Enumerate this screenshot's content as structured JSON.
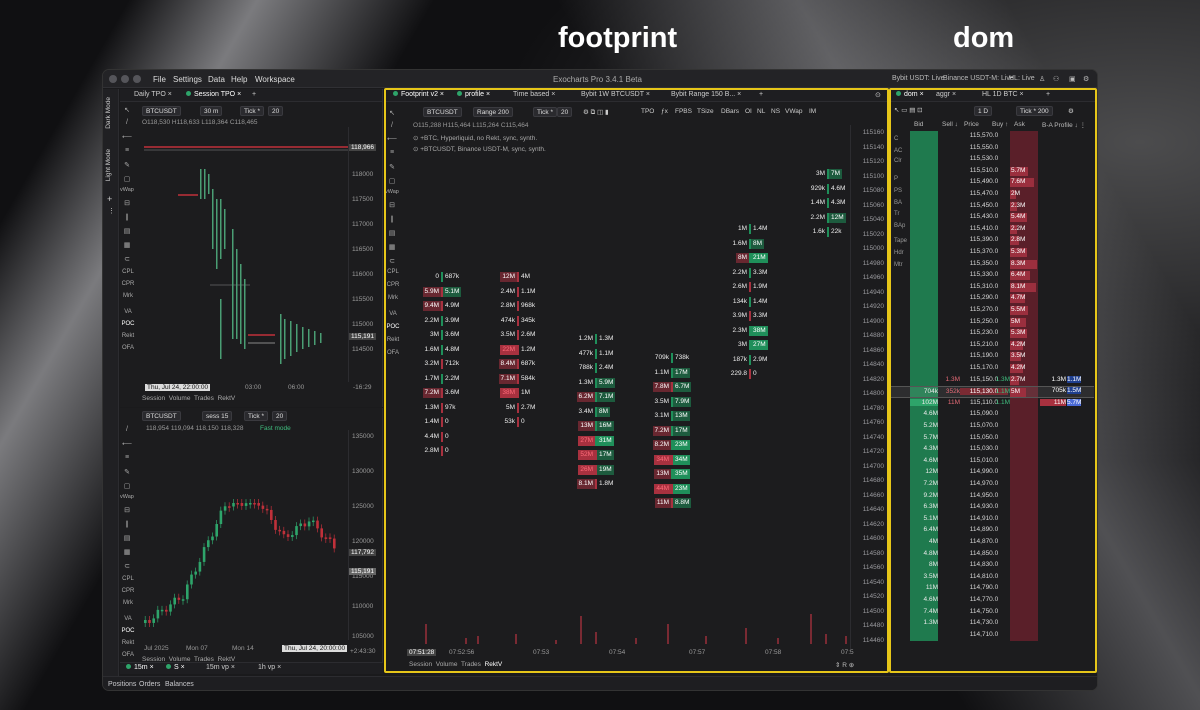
{
  "headings": {
    "footprint": "footprint",
    "dom": "dom"
  },
  "window": {
    "title": "Exocharts Pro 3.4.1 Beta",
    "menu": [
      "File",
      "Settings",
      "Data",
      "Help",
      "Workspace"
    ],
    "status": [
      "Bybit USDT: Live",
      "Binance USDT-M: Live",
      "HL: Live"
    ]
  },
  "side_labels": {
    "dark": "Dark Mode",
    "light": "Light Mode"
  },
  "tpo_pane": {
    "tabs": [
      "Daily TPO",
      "Session TPO"
    ],
    "symbol": "BTCUSDT",
    "tf": "30 m",
    "tick": "Tick *",
    "tick_val": "20",
    "ohlc": "O118,530 H118,633 L118,364 C118,465",
    "yaxis": [
      "118500",
      "118000",
      "117500",
      "117000",
      "116500",
      "116000",
      "115500",
      "115000",
      "114500"
    ],
    "tag_hi": "118,966",
    "tag_lo": "115,191",
    "date": "Thu, Jul 24, 22:00:00",
    "x": [
      "03:00",
      "06:00"
    ],
    "timer": "-16:29",
    "bottom": [
      "Session",
      "Volume",
      "Trades",
      "RektV"
    ]
  },
  "candle_pane": {
    "symbol": "BTCUSDT",
    "sess": "sess 15",
    "tick": "Tick *",
    "tick_val": "20",
    "ohlc": "118,954  119,094  118,150  118,328",
    "mode": "Fast mode",
    "yaxis": [
      "135000",
      "130000",
      "125000",
      "120000",
      "115000",
      "110000",
      "105000"
    ],
    "tag_a": "117,792",
    "tag_b": "115,191",
    "x": [
      "Jul 2025",
      "Mon 07",
      "Mon 14"
    ],
    "date": "Thu, Jul 24, 20:00:00",
    "timer": "+2:43:30",
    "bottom": [
      "Session",
      "Volume",
      "Trades",
      "RektV"
    ],
    "layout_tabs": [
      "15m",
      "S",
      "15m vp",
      "1h vp"
    ]
  },
  "left_tools": [
    "vWap",
    "CPL",
    "CPR",
    "Mrk",
    "VA",
    "POC",
    "Rekt",
    "OFA"
  ],
  "footprint_pane": {
    "tabs": [
      "Footprint v2",
      "profile",
      "Time based",
      "Bybit 1W BTCUSDT",
      "Bybit Range 150 B..."
    ],
    "symbol": "BTCUSDT",
    "range": "Range 200",
    "tick": "Tick *",
    "tick_val": "20",
    "toolbar": [
      "TPO",
      "FPBS",
      "TSize",
      "DBars",
      "OI",
      "NL",
      "NS",
      "VWap",
      "IM"
    ],
    "ohlc": "O115,288 H115,464 L115,264 C115,464",
    "sources": [
      "+BTC, Hyperliquid, no Rekt, sync, synth.",
      "+BTCUSDT, Binance USDT-M, sync, synth."
    ],
    "yaxis": [
      "115160",
      "115140",
      "115120",
      "115100",
      "115080",
      "115060",
      "115040",
      "115020",
      "115000",
      "114980",
      "114960",
      "114940",
      "114920",
      "114900",
      "114880",
      "114860",
      "114840",
      "114820",
      "114800",
      "114780",
      "114760",
      "114740",
      "114720",
      "114700",
      "114680",
      "114660",
      "114640",
      "114620",
      "114600",
      "114580",
      "114560",
      "114540",
      "114520",
      "114500",
      "114480",
      "114460"
    ],
    "time_tag": "07:51:28",
    "x": [
      "07:52:56",
      "07:53",
      "07:54",
      "07:57",
      "07:58",
      "07:5"
    ],
    "bottom": [
      "Session",
      "Volume",
      "Trades",
      "RektV"
    ],
    "columns": [
      [
        [
          "0",
          "687k"
        ],
        [
          "5.9M",
          "5.1M"
        ],
        [
          "9.4M",
          "4.9M"
        ],
        [
          "2.2M",
          "3.9M"
        ],
        [
          "3M",
          "3.6M"
        ],
        [
          "1.6M",
          "4.8M"
        ],
        [
          "3.2M",
          "712k"
        ],
        [
          "1.7M",
          "2.2M"
        ],
        [
          "7.2M",
          "3.6M"
        ],
        [
          "1.3M",
          "97k"
        ],
        [
          "1.4M",
          "0"
        ],
        [
          "4.4M",
          "0"
        ],
        [
          "2.8M",
          "0"
        ]
      ],
      [
        [
          "12M",
          "4M"
        ],
        [
          "2.4M",
          "1.1M"
        ],
        [
          "2.8M",
          "968k"
        ],
        [
          "474k",
          "345k"
        ],
        [
          "3.5M",
          "2.6M"
        ],
        [
          "22M",
          "1.2M"
        ],
        [
          "8.4M",
          "687k"
        ],
        [
          "7.1M",
          "584k"
        ],
        [
          "38M",
          "1M"
        ],
        [
          "5M",
          "2.7M"
        ],
        [
          "53k",
          "0"
        ]
      ],
      [
        [
          "1.2M",
          "1.3M"
        ],
        [
          "477k",
          "1.1M"
        ],
        [
          "788k",
          "2.4M"
        ],
        [
          "1.3M",
          "5.9M"
        ],
        [
          "6.2M",
          "7.1M"
        ],
        [
          "3.4M",
          "8M"
        ],
        [
          "13M",
          "16M"
        ],
        [
          "27M",
          "31M"
        ],
        [
          "52M",
          "17M"
        ],
        [
          "26M",
          "19M"
        ],
        [
          "8.1M",
          "1.8M"
        ]
      ],
      [
        [
          "709k",
          "738k"
        ],
        [
          "1.1M",
          "17M"
        ],
        [
          "7.8M",
          "6.7M"
        ],
        [
          "3.5M",
          "7.9M"
        ],
        [
          "3.1M",
          "13M"
        ],
        [
          "7.2M",
          "17M"
        ],
        [
          "8.2M",
          "23M"
        ],
        [
          "34M",
          "34M"
        ],
        [
          "13M",
          "35M"
        ],
        [
          "44M",
          "23M"
        ],
        [
          "11M",
          "8.8M"
        ]
      ],
      [
        [
          "1M",
          "1.4M"
        ],
        [
          "1.6M",
          "8M"
        ],
        [
          "8M",
          "21M"
        ],
        [
          "2.2M",
          "3.3M"
        ],
        [
          "2.6M",
          "1.9M"
        ],
        [
          "134k",
          "1.4M"
        ],
        [
          "3.9M",
          "3.3M"
        ],
        [
          "2.3M",
          "38M"
        ],
        [
          "3M",
          "27M"
        ],
        [
          "187k",
          "2.9M"
        ],
        [
          "229.8",
          "0"
        ]
      ],
      [
        [
          "3M",
          "7M"
        ],
        [
          "929k",
          "4.6M"
        ],
        [
          "1.4M",
          "4.3M"
        ],
        [
          "2.2M",
          "12M"
        ],
        [
          "1.6k",
          "22k"
        ]
      ]
    ]
  },
  "dom_pane": {
    "tabs": [
      "dom",
      "aggr",
      "HL 1D BTC"
    ],
    "tick": "Tick * 200",
    "scale": "1 D",
    "headers": [
      "Bid",
      "Sell",
      "Price",
      "Buy",
      "Ask",
      "B-A Profile"
    ],
    "side_codes": [
      "C",
      "AC",
      "Clr",
      "P",
      "PS",
      "BA",
      "Tr",
      "BAp",
      "Tape",
      "Hdr",
      "Mtr"
    ],
    "rows": [
      {
        "bid": "",
        "sell": "",
        "price": "115,570.0",
        "buy": "",
        "ask": ""
      },
      {
        "bid": "",
        "sell": "",
        "price": "115,550.0",
        "buy": "",
        "ask": ""
      },
      {
        "bid": "",
        "sell": "",
        "price": "115,530.0",
        "buy": "",
        "ask": ""
      },
      {
        "bid": "",
        "sell": "",
        "price": "115,510.0",
        "buy": "",
        "ask": "5.7M"
      },
      {
        "bid": "",
        "sell": "",
        "price": "115,490.0",
        "buy": "",
        "ask": "7.6M"
      },
      {
        "bid": "",
        "sell": "",
        "price": "115,470.0",
        "buy": "",
        "ask": "2M"
      },
      {
        "bid": "",
        "sell": "",
        "price": "115,450.0",
        "buy": "",
        "ask": "2.3M"
      },
      {
        "bid": "",
        "sell": "",
        "price": "115,430.0",
        "buy": "",
        "ask": "5.4M"
      },
      {
        "bid": "",
        "sell": "",
        "price": "115,410.0",
        "buy": "",
        "ask": "2.2M"
      },
      {
        "bid": "",
        "sell": "",
        "price": "115,390.0",
        "buy": "",
        "ask": "2.8M"
      },
      {
        "bid": "",
        "sell": "",
        "price": "115,370.0",
        "buy": "",
        "ask": "5.3M"
      },
      {
        "bid": "",
        "sell": "",
        "price": "115,350.0",
        "buy": "",
        "ask": "8.3M"
      },
      {
        "bid": "",
        "sell": "",
        "price": "115,330.0",
        "buy": "",
        "ask": "6.4M"
      },
      {
        "bid": "",
        "sell": "",
        "price": "115,310.0",
        "buy": "",
        "ask": "8.1M"
      },
      {
        "bid": "",
        "sell": "",
        "price": "115,290.0",
        "buy": "",
        "ask": "4.7M"
      },
      {
        "bid": "",
        "sell": "",
        "price": "115,270.0",
        "buy": "",
        "ask": "5.5M"
      },
      {
        "bid": "",
        "sell": "",
        "price": "115,250.0",
        "buy": "",
        "ask": "5M"
      },
      {
        "bid": "",
        "sell": "",
        "price": "115,230.0",
        "buy": "",
        "ask": "5.3M"
      },
      {
        "bid": "",
        "sell": "",
        "price": "115,210.0",
        "buy": "",
        "ask": "4.2M"
      },
      {
        "bid": "",
        "sell": "",
        "price": "115,190.0",
        "buy": "",
        "ask": "3.5M"
      },
      {
        "bid": "",
        "sell": "",
        "price": "115,170.0",
        "buy": "",
        "ask": "4.2M"
      },
      {
        "bid": "",
        "sell": "1.3M",
        "price": "115,150.0",
        "buy": "1.3M",
        "ask": "2.7M"
      },
      {
        "bid": "704k",
        "sell": "352k",
        "price": "115,130.0",
        "buy": "1.1M",
        "ask": "5M"
      },
      {
        "bid": "102M",
        "sell": "11M",
        "price": "115,110.0",
        "buy": "1.1M",
        "ask": ""
      },
      {
        "bid": "4.6M",
        "sell": "",
        "price": "115,090.0",
        "buy": "",
        "ask": ""
      },
      {
        "bid": "5.2M",
        "sell": "",
        "price": "115,070.0",
        "buy": "",
        "ask": ""
      },
      {
        "bid": "5.7M",
        "sell": "",
        "price": "115,050.0",
        "buy": "",
        "ask": ""
      },
      {
        "bid": "4.3M",
        "sell": "",
        "price": "115,030.0",
        "buy": "",
        "ask": ""
      },
      {
        "bid": "4.6M",
        "sell": "",
        "price": "115,010.0",
        "buy": "",
        "ask": ""
      },
      {
        "bid": "12M",
        "sell": "",
        "price": "114,990.0",
        "buy": "",
        "ask": ""
      },
      {
        "bid": "7.2M",
        "sell": "",
        "price": "114,970.0",
        "buy": "",
        "ask": ""
      },
      {
        "bid": "9.2M",
        "sell": "",
        "price": "114,950.0",
        "buy": "",
        "ask": ""
      },
      {
        "bid": "6.3M",
        "sell": "",
        "price": "114,930.0",
        "buy": "",
        "ask": ""
      },
      {
        "bid": "5.1M",
        "sell": "",
        "price": "114,910.0",
        "buy": "",
        "ask": ""
      },
      {
        "bid": "6.4M",
        "sell": "",
        "price": "114,890.0",
        "buy": "",
        "ask": ""
      },
      {
        "bid": "4M",
        "sell": "",
        "price": "114,870.0",
        "buy": "",
        "ask": ""
      },
      {
        "bid": "4.8M",
        "sell": "",
        "price": "114,850.0",
        "buy": "",
        "ask": ""
      },
      {
        "bid": "8M",
        "sell": "",
        "price": "114,830.0",
        "buy": "",
        "ask": ""
      },
      {
        "bid": "3.5M",
        "sell": "",
        "price": "114,810.0",
        "buy": "",
        "ask": ""
      },
      {
        "bid": "11M",
        "sell": "",
        "price": "114,790.0",
        "buy": "",
        "ask": ""
      },
      {
        "bid": "4.6M",
        "sell": "",
        "price": "114,770.0",
        "buy": "",
        "ask": ""
      },
      {
        "bid": "7.4M",
        "sell": "",
        "price": "114,750.0",
        "buy": "",
        "ask": ""
      },
      {
        "bid": "1.3M",
        "sell": "",
        "price": "114,730.0",
        "buy": "",
        "ask": ""
      },
      {
        "bid": "",
        "sell": "",
        "price": "114,710.0",
        "buy": "",
        "ask": ""
      }
    ],
    "profile": [
      [
        "1.3M",
        "1.1M"
      ],
      [
        "705k",
        "1.5M"
      ],
      [
        "11M",
        "5.7M"
      ]
    ]
  },
  "bottom_bar": [
    "Positions",
    "Orders",
    "Balances"
  ],
  "colors": {
    "buy": "#1f8f5a",
    "sell": "#a8313f",
    "highlight": "#e6c619",
    "bg": "#1c1c1e"
  }
}
